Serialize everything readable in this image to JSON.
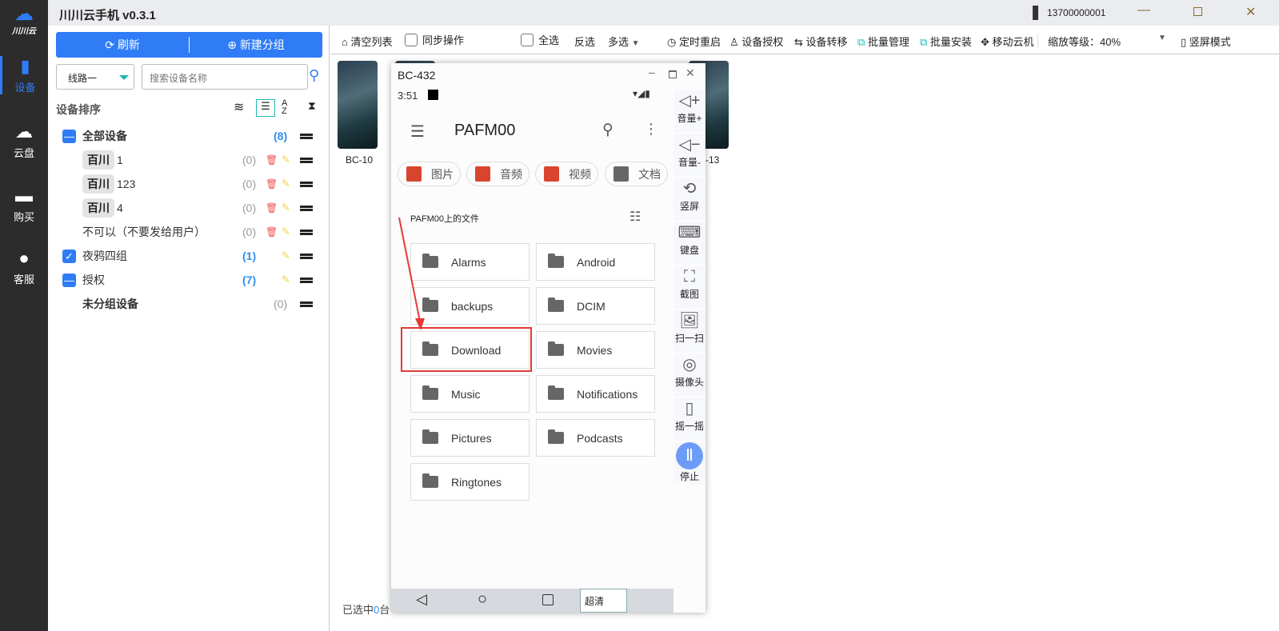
{
  "app": {
    "title": "川川云手机 v0.3.1",
    "logo_text": "川川云",
    "account": "13700000001"
  },
  "sidebar": {
    "items": [
      {
        "label": "设备",
        "icon": "phone-icon",
        "active": true
      },
      {
        "label": "云盘",
        "icon": "cloud-upload-icon"
      },
      {
        "label": "购买",
        "icon": "card-icon"
      },
      {
        "label": "客服",
        "icon": "support-icon"
      }
    ]
  },
  "left": {
    "refresh": "刷新",
    "new_group": "新建分组",
    "line_select": "线路一",
    "search_placeholder": "搜索设备名称",
    "sort_title": "设备排序",
    "groups": [
      {
        "tag": "",
        "name": "全部设备",
        "count": "(8)",
        "bold": true,
        "check": "partial",
        "highlight": true
      },
      {
        "tag": "百川",
        "name": "1",
        "count": "(0)"
      },
      {
        "tag": "百川",
        "name": "123",
        "count": "(0)"
      },
      {
        "tag": "百川",
        "name": "4",
        "count": "(0)"
      },
      {
        "tag": "",
        "name": "不可以（不要发给用户）",
        "count": "(0)"
      },
      {
        "tag": "",
        "name": "夜鸦四组",
        "count": "(1)",
        "check": "checked",
        "highlight": true
      },
      {
        "tag": "",
        "name": "授权",
        "count": "(7)",
        "check": "partial",
        "highlight": true
      },
      {
        "tag": "",
        "name": "未分组设备",
        "count": "(0)",
        "bold": true
      }
    ]
  },
  "toolbar": {
    "clear_list": "清空列表",
    "sync": "同步操作",
    "select_all": "全选",
    "invert": "反选",
    "multi": "多选",
    "timed_restart": "定时重启",
    "authorize": "设备授权",
    "transfer": "设备转移",
    "batch_manage": "批量管理",
    "batch_install": "批量安装",
    "move": "移动云机",
    "zoom_label": "缩放等级：40%",
    "portrait_mode": "竖屏模式"
  },
  "devices": {
    "first_label": "BC-10",
    "last_label": "-13"
  },
  "status": {
    "prefix": "已选中",
    "count": "0",
    "suffix": "台"
  },
  "popup": {
    "title": "BC-432",
    "time": "3:51",
    "app_title": "PAFM00",
    "categories": [
      "图片",
      "音频",
      "视频",
      "文档"
    ],
    "section": "PAFM00上的文件",
    "folders": [
      "Alarms",
      "Android",
      "backups",
      "DCIM",
      "Download",
      "Movies",
      "Music",
      "Notifications",
      "Pictures",
      "Podcasts",
      "Ringtones"
    ],
    "highlighted_folder": "Download",
    "quality": "超清",
    "side_tools": [
      {
        "label": "音量+",
        "icon": "volume-up-icon"
      },
      {
        "label": "音量-",
        "icon": "volume-down-icon"
      },
      {
        "label": "竖屏",
        "icon": "rotate-icon"
      },
      {
        "label": "键盘",
        "icon": "keyboard-icon"
      },
      {
        "label": "截图",
        "icon": "screenshot-icon"
      },
      {
        "label": "扫一扫",
        "icon": "scan-icon"
      },
      {
        "label": "摄像头",
        "icon": "camera-icon"
      },
      {
        "label": "摇一摇",
        "icon": "shake-icon"
      },
      {
        "label": "停止",
        "icon": "stop-icon"
      }
    ]
  },
  "colors": {
    "accent": "#2f7cf6",
    "highlight_box": "#e53935"
  }
}
